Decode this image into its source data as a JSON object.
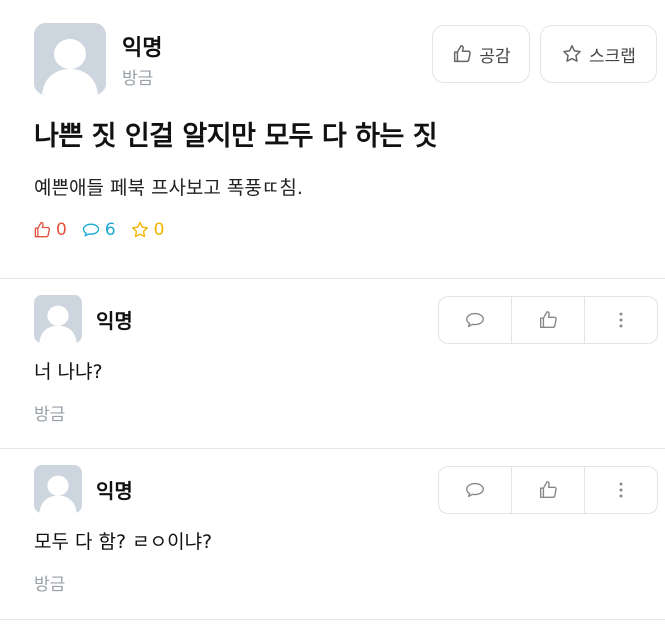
{
  "post": {
    "author": "익명",
    "time": "방금",
    "like_button_label": "공감",
    "scrap_button_label": "스크랩",
    "title": "나쁜 짓 인걸 알지만 모두 다 하는 짓",
    "body": "예쁜애들 페북 프사보고 폭풍ㄸ침.",
    "counts": {
      "likes": "0",
      "comments": "6",
      "scraps": "0"
    }
  },
  "comments": [
    {
      "author": "익명",
      "text": "너 나냐?",
      "time": "방금"
    },
    {
      "author": "익명",
      "text": "모두 다 함? ㄹㅇ이냐?",
      "time": "방금"
    }
  ],
  "colors": {
    "like": "#e2523f",
    "comment": "#1aaad6",
    "scrap": "#f0b400",
    "muted": "#9aa0a8"
  },
  "icons": [
    "avatar-placeholder-icon",
    "thumbs-up-icon",
    "star-icon",
    "speech-bubble-icon",
    "more-vertical-icon"
  ]
}
